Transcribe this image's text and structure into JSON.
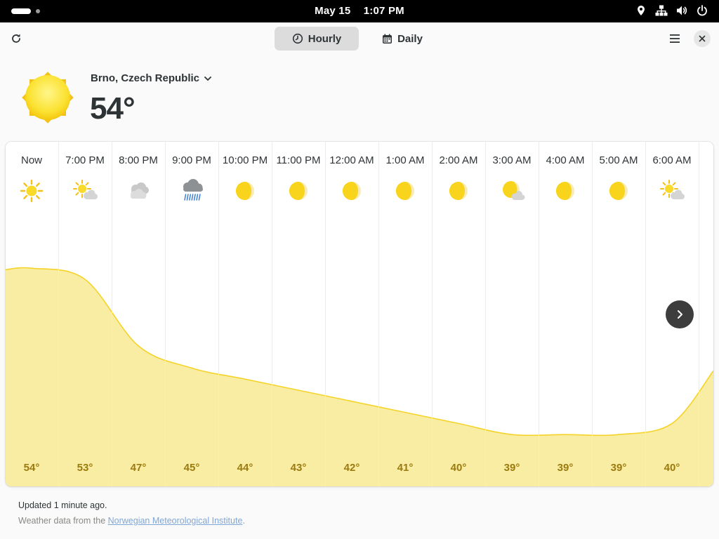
{
  "system_bar": {
    "date": "May 15",
    "time": "1:07 PM",
    "icons": [
      "location-icon",
      "network-icon",
      "volume-icon",
      "power-icon"
    ]
  },
  "header": {
    "tabs": [
      {
        "label": "Hourly",
        "icon": "clock-icon",
        "active": true
      },
      {
        "label": "Daily",
        "icon": "calendar-icon",
        "active": false
      }
    ],
    "refresh_icon": "refresh-icon",
    "menu_icon": "hamburger-menu-icon",
    "close_icon": "close-icon"
  },
  "current": {
    "location": "Brno, Czech Republic",
    "temperature": "54°",
    "icon": "sunny-icon"
  },
  "hourly": [
    {
      "time": "Now",
      "icon": "sun",
      "temp": "54°",
      "value": 54
    },
    {
      "time": "7:00 PM",
      "icon": "sun-cloud",
      "temp": "53°",
      "value": 53
    },
    {
      "time": "8:00 PM",
      "icon": "cloud",
      "temp": "47°",
      "value": 47
    },
    {
      "time": "9:00 PM",
      "icon": "rain",
      "temp": "45°",
      "value": 45
    },
    {
      "time": "10:00 PM",
      "icon": "moon",
      "temp": "44°",
      "value": 44
    },
    {
      "time": "11:00 PM",
      "icon": "moon",
      "temp": "43°",
      "value": 43
    },
    {
      "time": "12:00 AM",
      "icon": "moon",
      "temp": "42°",
      "value": 42
    },
    {
      "time": "1:00 AM",
      "icon": "moon",
      "temp": "41°",
      "value": 41
    },
    {
      "time": "2:00 AM",
      "icon": "moon",
      "temp": "40°",
      "value": 40
    },
    {
      "time": "3:00 AM",
      "icon": "moon-cloud",
      "temp": "39°",
      "value": 39
    },
    {
      "time": "4:00 AM",
      "icon": "moon",
      "temp": "39°",
      "value": 39
    },
    {
      "time": "5:00 AM",
      "icon": "moon",
      "temp": "39°",
      "value": 39
    },
    {
      "time": "6:00 AM",
      "icon": "sun-cloud",
      "temp": "40°",
      "value": 40
    }
  ],
  "colors": {
    "temperature_fill": "#f9eda4",
    "temperature_line": "#f5d328",
    "temperature_text": "#9c7a0e"
  },
  "footer": {
    "updated": "Updated 1 minute ago.",
    "source_prefix": "Weather data from the ",
    "source_link": "Norwegian Meteorological Institute",
    "source_suffix": "."
  }
}
